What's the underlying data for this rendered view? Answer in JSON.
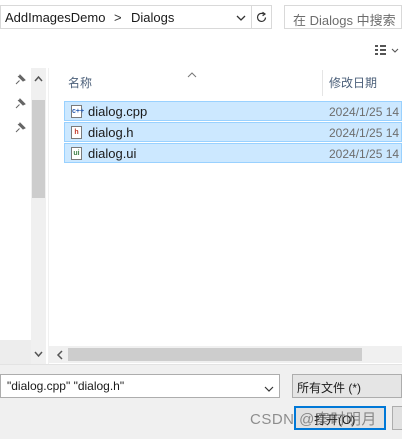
{
  "address": {
    "crumbs": [
      "AddImagesDemo",
      "Dialogs"
    ],
    "separator": ">"
  },
  "search": {
    "placeholder": "在 Dialogs 中搜索"
  },
  "list": {
    "columns": {
      "name": "名称",
      "date_modified": "修改日期"
    },
    "files": [
      {
        "name": "dialog.cpp",
        "date": "2024/1/25 14",
        "icon": "cpp-file-icon",
        "glyph": "c++",
        "glyph_color": "#2b5fb3"
      },
      {
        "name": "dialog.h",
        "date": "2024/1/25 14",
        "icon": "header-file-icon",
        "glyph": "h",
        "glyph_color": "#c0392b"
      },
      {
        "name": "dialog.ui",
        "date": "2024/1/25 14",
        "icon": "ui-file-icon",
        "glyph": "ui",
        "glyph_color": "#3a7d44"
      }
    ]
  },
  "bottom": {
    "filename_value": "\"dialog.cpp\" \"dialog.h\"",
    "filter_value": "所有文件 (*)",
    "open_label": "打开(O)"
  },
  "watermark": "CSDN @秦时明月",
  "colors": {
    "selection_bg": "#cce8ff",
    "selection_border": "#99d1ff",
    "accent": "#0078d7"
  }
}
